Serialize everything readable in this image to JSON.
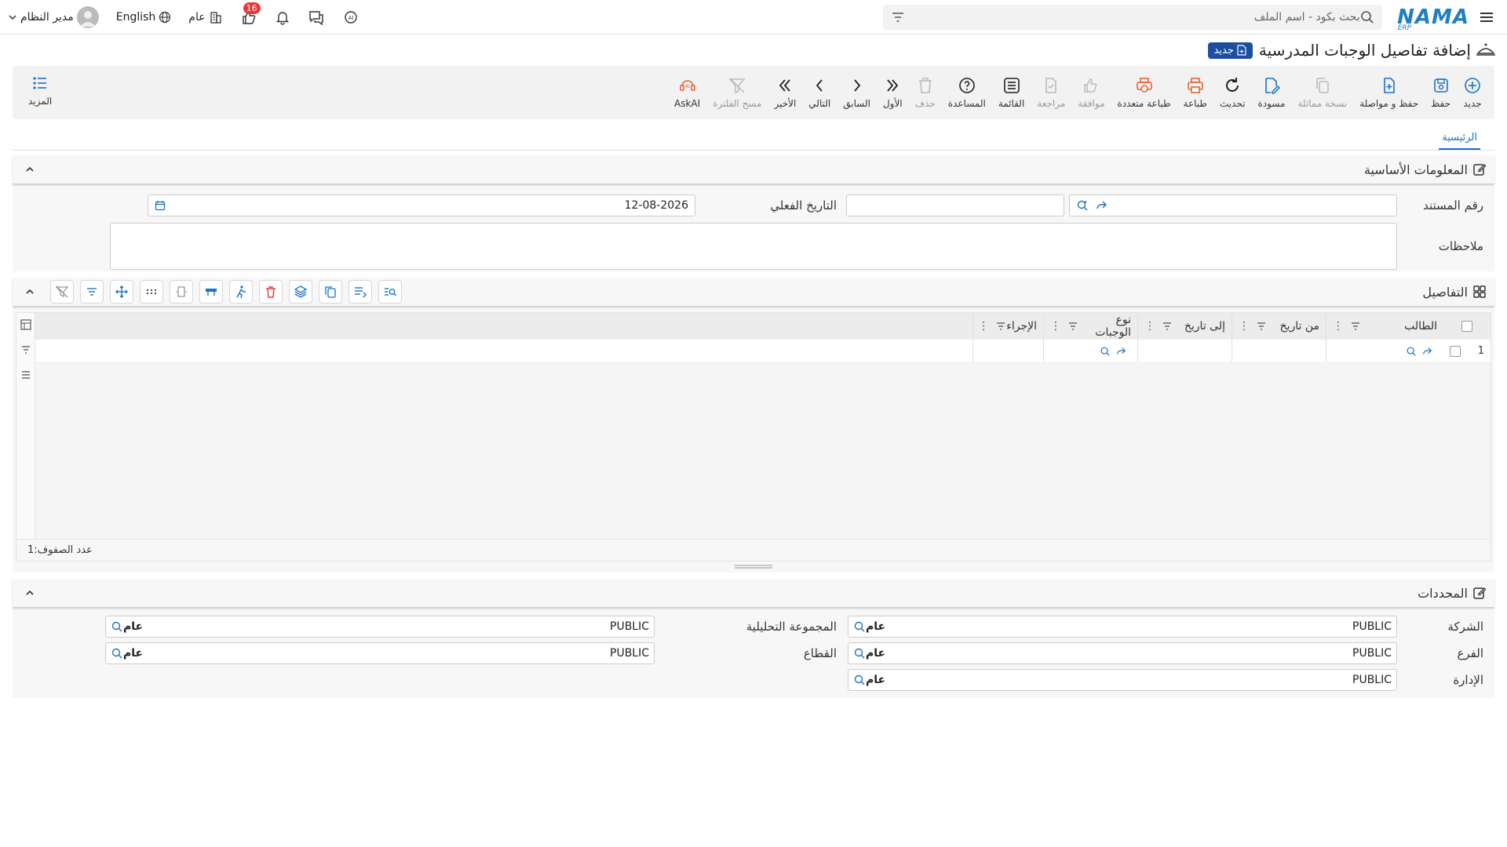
{
  "topbar": {
    "logo": "NAMA",
    "logo_sub": "ERP",
    "search_placeholder": "بحث بكود - اسم الملف",
    "user_name": "مدير النظام",
    "language": "English",
    "branch": "عام",
    "notifications_count": "16"
  },
  "page": {
    "title": "إضافة تفاصيل الوجبات المدرسية",
    "status_badge": "جديد"
  },
  "toolbar": {
    "new": "جديد",
    "save": "حفظ",
    "save_continue": "حفظ و مواصلة",
    "copy": "نسخة مماثلة",
    "draft": "مسودة",
    "refresh": "تحديث",
    "print": "طباعة",
    "multi_print": "طباعة متعددة",
    "approve": "موافقة",
    "review": "مراجعة",
    "list": "القائمة",
    "help": "المساعدة",
    "delete": "حذف",
    "first": "الأول",
    "previous": "السابق",
    "next": "التالي",
    "last": "الأخير",
    "clear_filter": "مسح الفلترة",
    "askai": "AskAI",
    "more": "المزيد"
  },
  "tabs": [
    "الرئيسية"
  ],
  "basic_info": {
    "title": "المعلومات الأساسية",
    "doc_number_label": "رقم المستند",
    "doc_number_value": "",
    "actual_date_label": "التاريخ الفعلي",
    "actual_date_value": "12-08-2026",
    "notes_label": "ملاحظات",
    "notes_value": ""
  },
  "details": {
    "title": "التفاصيل",
    "columns": [
      "الطالب",
      "من تاريخ",
      "إلى تاريخ",
      "نوع الوجبات",
      "الإجراء"
    ],
    "rows": [
      {
        "num": "1",
        "student": "",
        "from": "",
        "to": "",
        "meal_type": "",
        "action": ""
      }
    ],
    "row_count_label": "عدد الصفوف:",
    "row_count_value": "1"
  },
  "determinants": {
    "title": "المحددات",
    "company_label": "الشركة",
    "company_code": "PUBLIC",
    "company_name": "عام",
    "branch_label": "الفرع",
    "branch_code": "PUBLIC",
    "branch_name": "عام",
    "department_label": "الإدارة",
    "department_code": "PUBLIC",
    "department_name": "عام",
    "analytic_label": "المجموعة التحليلية",
    "analytic_code": "PUBLIC",
    "analytic_name": "عام",
    "sector_label": "القطاع",
    "sector_code": "PUBLIC",
    "sector_name": "عام"
  },
  "colors": {
    "accent": "#1a73c7",
    "badge": "#1c4fa0",
    "print_icon": "#e8622c",
    "notification": "#e53935"
  }
}
